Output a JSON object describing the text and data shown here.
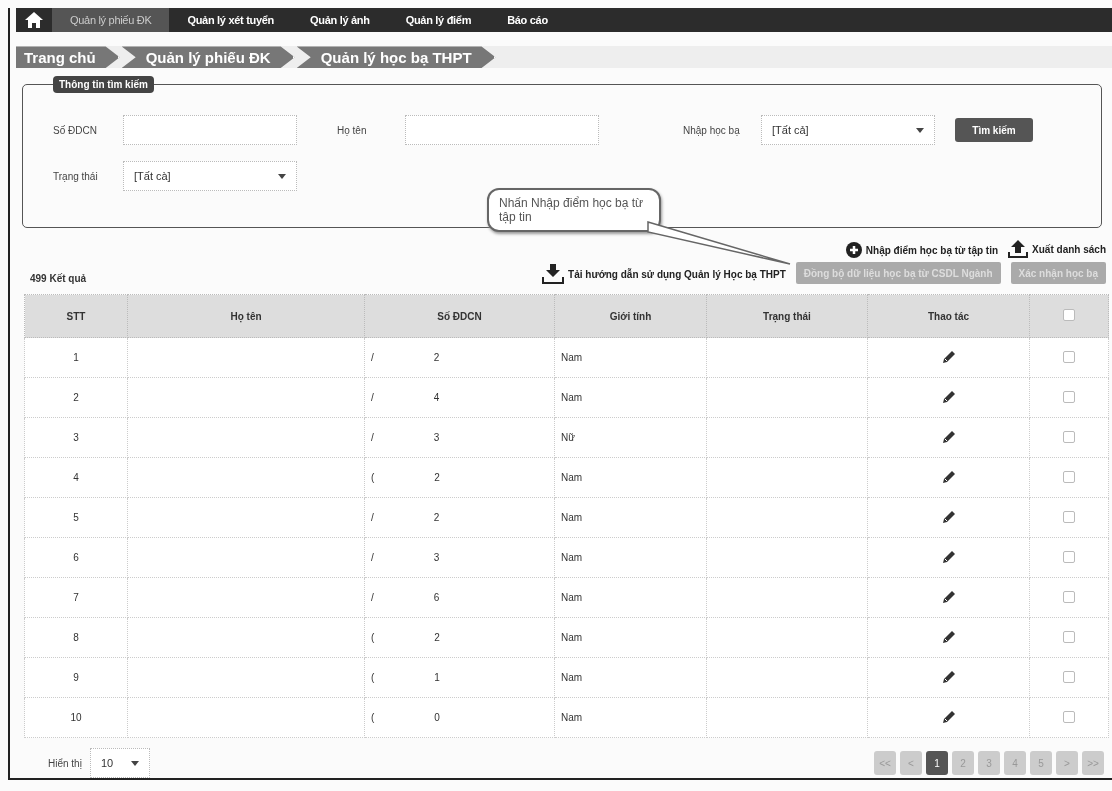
{
  "nav": {
    "items": [
      {
        "label": "Quản lý phiếu ĐK",
        "selected": true
      },
      {
        "label": "Quản lý xét tuyển",
        "selected": false
      },
      {
        "label": "Quản lý ảnh",
        "selected": false
      },
      {
        "label": "Quản lý điểm",
        "selected": false
      },
      {
        "label": "Báo cáo",
        "selected": false
      }
    ]
  },
  "breadcrumb": [
    "Trang chủ",
    "Quản lý phiếu ĐK",
    "Quản lý học bạ THPT"
  ],
  "search": {
    "legend": "Thông tin tìm kiếm",
    "fields": [
      {
        "label": "Số ĐDCN",
        "kind": "text"
      },
      {
        "label": "Họ tên",
        "kind": "text"
      },
      {
        "label": "Nhập học bạ",
        "kind": "select",
        "value": "[Tất cả]"
      },
      {
        "label": "Trạng thái",
        "kind": "select",
        "value": "[Tất cà]"
      }
    ],
    "button": "Tìm kiếm"
  },
  "callout": "Nhấn Nhập điểm học bạ từ tập tin",
  "result_count": "499 Kết quả",
  "actions": {
    "download_guide": "Tải hướng dẫn sử dụng Quản lý Học bạ THPT",
    "import": "Nhập điểm học bạ từ tập tin",
    "export": "Xuất danh sách",
    "sync_button": {
      "label": "Đồng bộ dữ liệu học bạ từ CSDL Ngành",
      "disabled": true
    },
    "confirm_button": {
      "label": "Xác nhận học bạ",
      "disabled": true
    }
  },
  "table": {
    "columns": [
      "STT",
      "Họ tên",
      "Số ĐDCN",
      "Giới tính",
      "Trạng thái",
      "Thao tác"
    ],
    "header_checked": false,
    "rows": [
      {
        "stt": "1",
        "id_mark": "/",
        "id_digit": "2",
        "gender": "Nam",
        "checked": false
      },
      {
        "stt": "2",
        "id_mark": "/",
        "id_digit": "4",
        "gender": "Nam",
        "checked": false
      },
      {
        "stt": "3",
        "id_mark": "/",
        "id_digit": "3",
        "gender": "Nữ",
        "checked": false
      },
      {
        "stt": "4",
        "id_mark": "(",
        "id_digit": "2",
        "gender": "Nam",
        "checked": false
      },
      {
        "stt": "5",
        "id_mark": "/",
        "id_digit": "2",
        "gender": "Nam",
        "checked": false
      },
      {
        "stt": "6",
        "id_mark": "/",
        "id_digit": "3",
        "gender": "Nam",
        "checked": false
      },
      {
        "stt": "7",
        "id_mark": "/",
        "id_digit": "6",
        "gender": "Nam",
        "checked": false
      },
      {
        "stt": "8",
        "id_mark": "(",
        "id_digit": "2",
        "gender": "Nam",
        "checked": false
      },
      {
        "stt": "9",
        "id_mark": "(",
        "id_digit": "1",
        "gender": "Nam",
        "checked": false
      },
      {
        "stt": "10",
        "id_mark": "(",
        "id_digit": "0",
        "gender": "Nam",
        "checked": false
      }
    ]
  },
  "footer": {
    "page_size_label": "Hiển thị",
    "page_size": "10"
  },
  "pagination": [
    {
      "label": "<<",
      "selected": false
    },
    {
      "label": "<",
      "selected": false
    },
    {
      "label": "1",
      "selected": true
    },
    {
      "label": "2",
      "selected": false
    },
    {
      "label": "3",
      "selected": false
    },
    {
      "label": "4",
      "selected": false
    },
    {
      "label": "5",
      "selected": false
    },
    {
      "label": ">",
      "selected": false
    },
    {
      "label": ">>",
      "selected": false
    }
  ]
}
